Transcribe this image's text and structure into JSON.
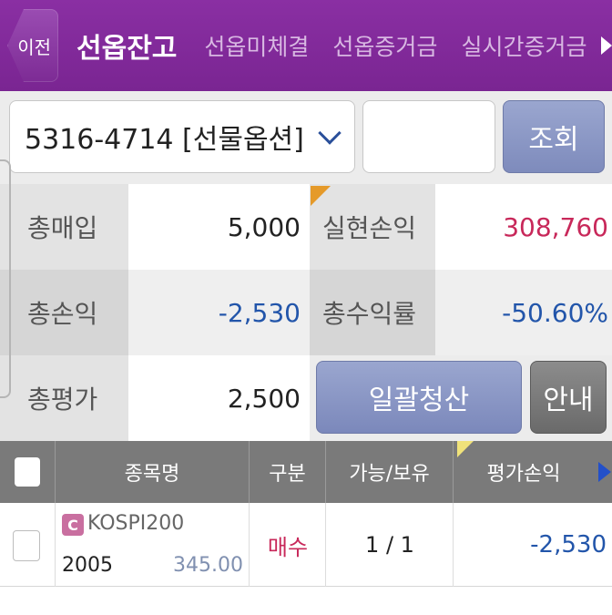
{
  "header": {
    "back_label": "이전",
    "tabs": [
      {
        "label": "선옵잔고",
        "active": true
      },
      {
        "label": "선옵미체결",
        "active": false
      },
      {
        "label": "선옵증거금",
        "active": false
      },
      {
        "label": "실시간증거금",
        "active": false
      }
    ]
  },
  "account": {
    "selected": "5316-4714 [선물옵션]",
    "password_value": "",
    "query_label": "조회"
  },
  "summary": {
    "total_purchase_label": "총매입",
    "total_purchase_value": "5,000",
    "realized_pnl_label": "실현손익",
    "realized_pnl_value": "308,760",
    "total_pnl_label": "총손익",
    "total_pnl_value": "-2,530",
    "total_return_label": "총수익률",
    "total_return_value": "-50.60%",
    "total_eval_label": "총평가",
    "total_eval_value": "2,500",
    "bulk_liquidate_label": "일괄청산",
    "guide_label": "안내"
  },
  "table": {
    "headers": {
      "name": "종목명",
      "side": "구분",
      "qty": "가능/보유",
      "eval_pnl": "평가손익"
    },
    "rows": [
      {
        "badge": "C",
        "name_line1": "KOSPI200",
        "name_line2": "2005",
        "price": "345.00",
        "side": "매수",
        "qty": "1 / 1",
        "eval_pnl": "-2,530"
      }
    ]
  },
  "colors": {
    "header_purple": "#7a2592",
    "negative_blue": "#2255aa",
    "positive_red": "#c8285a",
    "button_slate": "#7e8bbc"
  }
}
